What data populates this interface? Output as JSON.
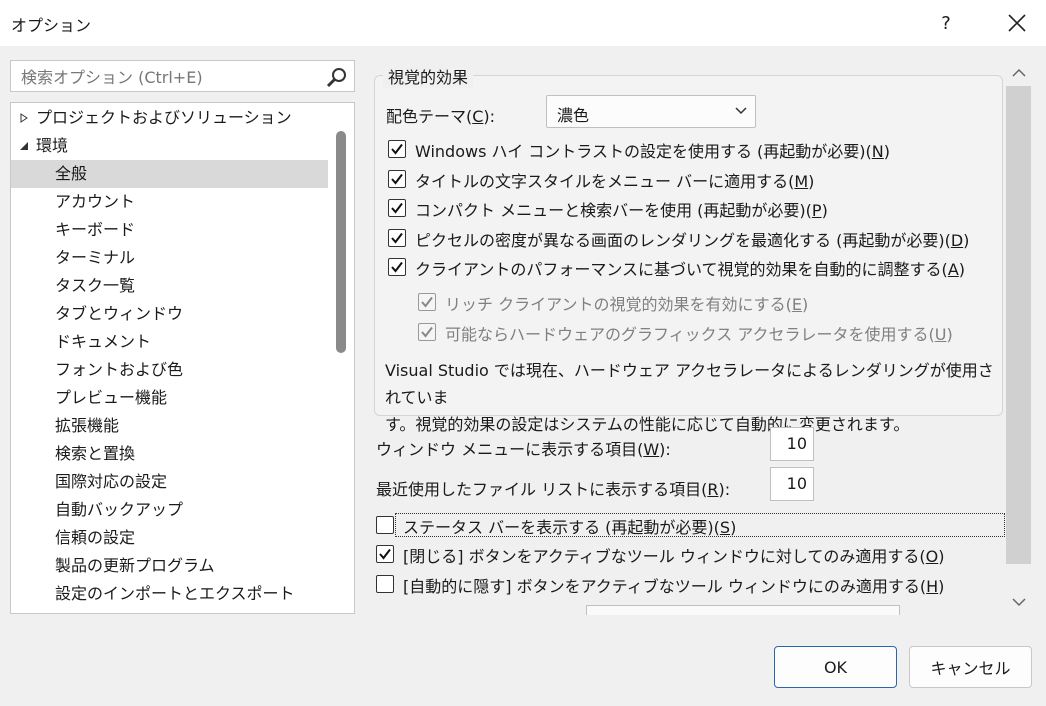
{
  "window": {
    "title": "オプション",
    "help_label": "?"
  },
  "search": {
    "placeholder": "検索オプション (Ctrl+E)"
  },
  "tree": {
    "items": [
      {
        "label": "プロジェクトおよびソリューション",
        "expander": "collapsed"
      },
      {
        "label": "環境",
        "expander": "expanded"
      },
      {
        "label": "全般",
        "selected": true
      },
      {
        "label": "アカウント"
      },
      {
        "label": "キーボード"
      },
      {
        "label": "ターミナル"
      },
      {
        "label": "タスク一覧"
      },
      {
        "label": "タブとウィンドウ"
      },
      {
        "label": "ドキュメント"
      },
      {
        "label": "フォントおよび色"
      },
      {
        "label": "プレビュー機能"
      },
      {
        "label": "拡張機能"
      },
      {
        "label": "検索と置換"
      },
      {
        "label": "国際対応の設定"
      },
      {
        "label": "自動バックアップ"
      },
      {
        "label": "信頼の設定"
      },
      {
        "label": "製品の更新プログラム"
      },
      {
        "label": "設定のインポートとエクスポート"
      }
    ]
  },
  "visual_effects": {
    "group_title": "視覚的効果",
    "theme_label_pre": "配色テーマ(",
    "theme_label_key": "C",
    "theme_label_post": "):",
    "theme_value": "濃色",
    "checkboxes": [
      {
        "pre": "Windows ハイ コントラストの設定を使用する (再起動が必要)(",
        "key": "N",
        "post": ")",
        "checked": true,
        "disabled": false
      },
      {
        "pre": "タイトルの文字スタイルをメニュー バーに適用する(",
        "key": "M",
        "post": ")",
        "checked": true,
        "disabled": false
      },
      {
        "pre": "コンパクト メニューと検索バーを使用 (再起動が必要)(",
        "key": "P",
        "post": ")",
        "checked": true,
        "disabled": false
      },
      {
        "pre": "ピクセルの密度が異なる画面のレンダリングを最適化する (再起動が必要)(",
        "key": "D",
        "post": ")",
        "checked": true,
        "disabled": false
      },
      {
        "pre": "クライアントのパフォーマンスに基づいて視覚的効果を自動的に調整する(",
        "key": "A",
        "post": ")",
        "checked": true,
        "disabled": false
      },
      {
        "pre": "リッチ クライアントの視覚的効果を有効にする(",
        "key": "E",
        "post": ")",
        "checked": true,
        "disabled": true
      },
      {
        "pre": "可能ならハードウェアのグラフィックス アクセラレータを使用する(",
        "key": "U",
        "post": ")",
        "checked": true,
        "disabled": true
      }
    ],
    "description_line1": "Visual Studio では現在、ハードウェア アクセラレータによるレンダリングが使用されていま",
    "description_line2": "す。視覚的効果の設定はシステムの性能に応じて自動的に変更されます。"
  },
  "window_menu": {
    "pre": "ウィンドウ メニューに表示する項目(",
    "key": "W",
    "post": "):",
    "value": "10"
  },
  "recent_files": {
    "pre": "最近使用したファイル リストに表示する項目(",
    "key": "R",
    "post": "):",
    "value": "10"
  },
  "options": [
    {
      "pre": "ステータス バーを表示する (再起動が必要)(",
      "key": "S",
      "post": ")",
      "checked": false
    },
    {
      "pre": "[閉じる] ボタンをアクティブなツール ウィンドウに対してのみ適用する(",
      "key": "O",
      "post": ")",
      "checked": true
    },
    {
      "pre": "[自動的に隠す] ボタンをアクティブなツール ウィンドウにのみ適用する(",
      "key": "H",
      "post": ")",
      "checked": false
    }
  ],
  "buttons": {
    "ok": "OK",
    "cancel": "キャンセル"
  }
}
